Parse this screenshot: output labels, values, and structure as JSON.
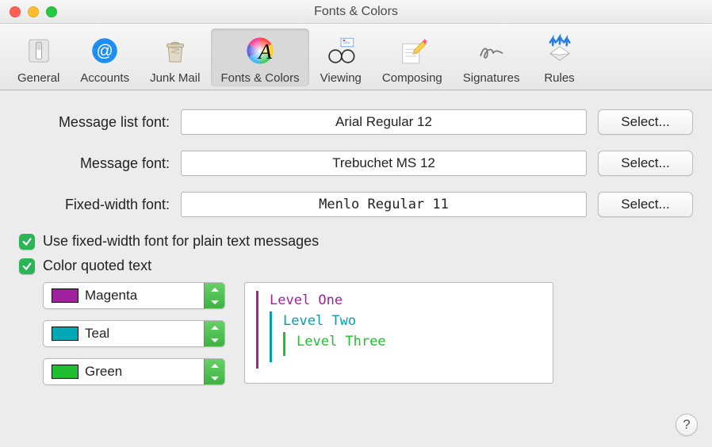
{
  "window": {
    "title": "Fonts & Colors"
  },
  "toolbar": {
    "items": [
      {
        "label": "General"
      },
      {
        "label": "Accounts"
      },
      {
        "label": "Junk Mail"
      },
      {
        "label": "Fonts & Colors"
      },
      {
        "label": "Viewing"
      },
      {
        "label": "Composing"
      },
      {
        "label": "Signatures"
      },
      {
        "label": "Rules"
      }
    ],
    "selected_index": 3
  },
  "fonts": {
    "rows": [
      {
        "label": "Message list font:",
        "value": "Arial Regular 12",
        "button": "Select..."
      },
      {
        "label": "Message font:",
        "value": "Trebuchet MS 12",
        "button": "Select..."
      },
      {
        "label": "Fixed-width font:",
        "value": "Menlo Regular 11",
        "button": "Select..."
      }
    ]
  },
  "options": {
    "use_fixed_width": {
      "checked": true,
      "label": "Use fixed-width font for plain text messages"
    },
    "color_quoted": {
      "checked": true,
      "label": "Color quoted text"
    }
  },
  "quote_colors": [
    {
      "name": "Magenta",
      "hex": "#a020a0"
    },
    {
      "name": "Teal",
      "hex": "#00a7b5"
    },
    {
      "name": "Green",
      "hex": "#1fbf2f"
    }
  ],
  "quote_preview": {
    "level1": "Level One",
    "level2": "Level Two",
    "level3": "Level Three"
  },
  "help_button": "?"
}
